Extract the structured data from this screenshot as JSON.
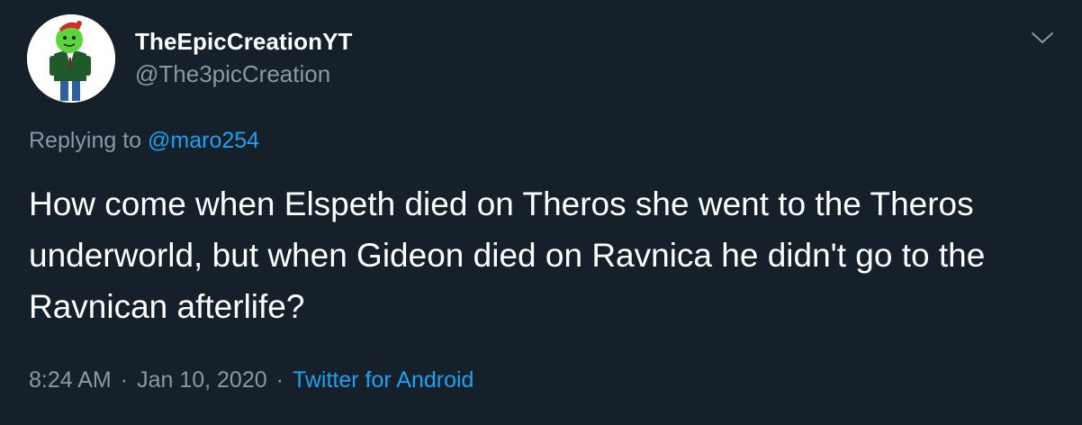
{
  "tweet": {
    "display_name": "TheEpicCreationYT",
    "handle": "@The3picCreation",
    "replying_prefix": "Replying to",
    "replying_mention": "@maro254",
    "text": "How come when Elspeth died on Theros she went to the Theros underworld, but when Gideon died on Ravnica he didn't go to the Ravnican afterlife?",
    "time": "8:24 AM",
    "separator": "·",
    "date": "Jan 10, 2020",
    "source": "Twitter for Android"
  },
  "icons": {
    "avatar": "avatar-cartoon-green-figure",
    "menu": "chevron-down-icon"
  },
  "colors": {
    "background": "#15202b",
    "primary_text": "#ffffff",
    "secondary_text": "#8899a6",
    "link": "#1da1f2"
  }
}
